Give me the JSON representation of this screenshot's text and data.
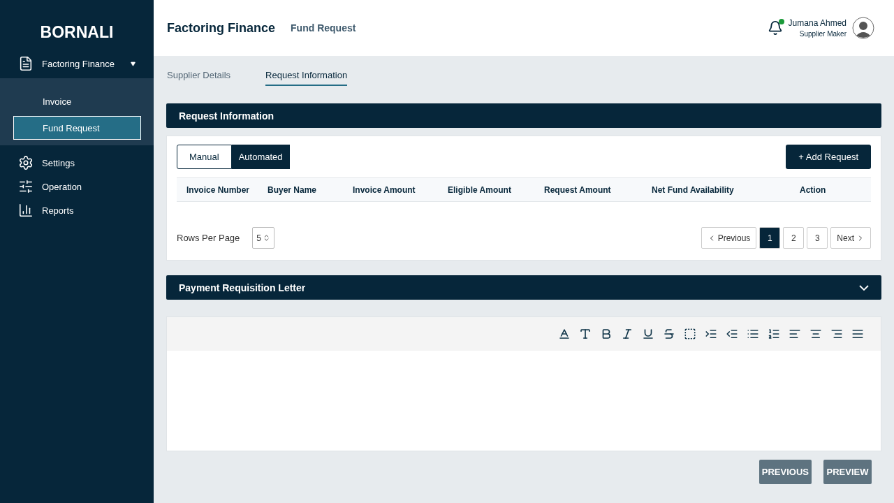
{
  "sidebar": {
    "brand": "BORNALI",
    "items": [
      {
        "kind": "group",
        "label": "Factoring Finance",
        "expanded": true,
        "children": [
          {
            "label": "Invoice",
            "selected": false
          },
          {
            "label": "Fund Request",
            "selected": true
          }
        ]
      },
      {
        "kind": "item",
        "label": "Settings"
      },
      {
        "kind": "item",
        "label": "Operation"
      },
      {
        "kind": "item",
        "label": "Reports"
      }
    ]
  },
  "header": {
    "title": "Factoring Finance",
    "subtitle": "Fund Request",
    "user": {
      "name": "Jumana Ahmed",
      "role": "Supplier Maker",
      "has_notification": true
    }
  },
  "tabs": [
    {
      "label": "Supplier Details",
      "selected": false
    },
    {
      "label": "Request Information",
      "selected": true
    }
  ],
  "request_panel": {
    "title": "Request Information",
    "mode_toggle": [
      {
        "label": "Manual",
        "selected": false
      },
      {
        "label": "Automated",
        "selected": true
      }
    ],
    "add_button": "+ Add Request",
    "table": {
      "columns": [
        "Invoice Number",
        "Buyer Name",
        "Invoice Amount",
        "Eligible Amount",
        "Request Amount",
        "Net Fund Availability",
        "Action"
      ]
    },
    "rows_per_page": {
      "label": "Rows Per Page",
      "value": "5"
    },
    "pagination": {
      "previous": "Previous",
      "next": "Next",
      "pages": [
        {
          "label": "1",
          "selected": true
        },
        {
          "label": "2",
          "selected": false
        },
        {
          "label": "3",
          "selected": false
        }
      ]
    }
  },
  "letter_panel": {
    "title": "Payment Requisition Letter",
    "expanded": true
  },
  "buttons": [
    "PREVIOUS",
    "PREVIEW"
  ]
}
